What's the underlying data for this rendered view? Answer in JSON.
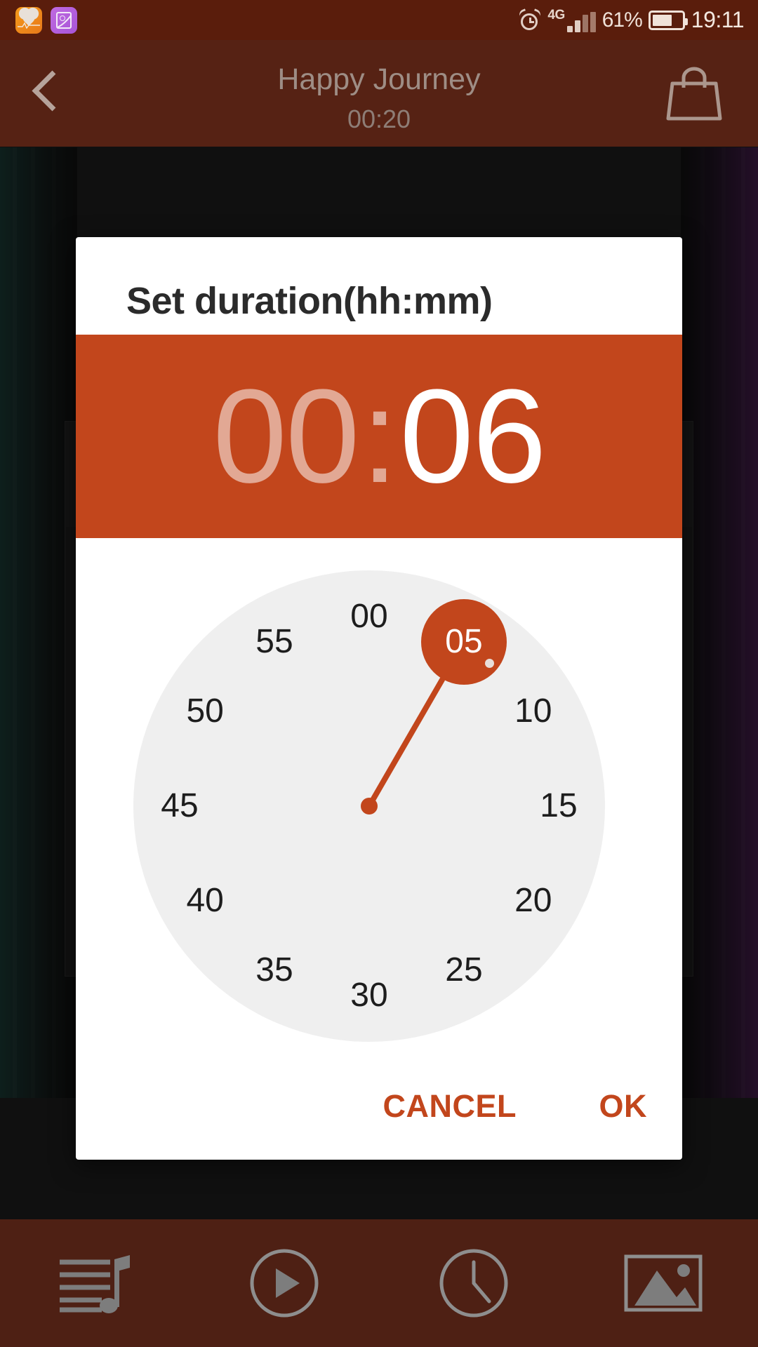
{
  "status_bar": {
    "app_icons": [
      "health-app-icon",
      "gallery-app-icon"
    ],
    "alarm_icon": "alarm-icon",
    "network_type": "4G",
    "signal_icon": "signal-bars-icon",
    "battery_percent": "61%",
    "battery_icon": "battery-icon",
    "battery_level": 60,
    "clock": "19:11",
    "background_color": "#5a1d0c"
  },
  "app_header": {
    "back_icon": "chevron-left-icon",
    "title": "Happy Journey",
    "subtitle": "00:20",
    "bag_icon": "shopping-bag-icon",
    "background_color": "#562214"
  },
  "dialog": {
    "title": "Set duration(hh:mm)",
    "accent_color": "#c2461c",
    "time": {
      "hours": "00",
      "separator": ":",
      "minutes": "06",
      "selected_field": "minutes"
    },
    "clock": {
      "mode": "minutes",
      "selected_value": "05",
      "dial_color": "#efefef",
      "labels": [
        {
          "text": "00",
          "angle": 0
        },
        {
          "text": "05",
          "angle": 30
        },
        {
          "text": "10",
          "angle": 60
        },
        {
          "text": "15",
          "angle": 90
        },
        {
          "text": "20",
          "angle": 120
        },
        {
          "text": "25",
          "angle": 150
        },
        {
          "text": "30",
          "angle": 180
        },
        {
          "text": "35",
          "angle": 210
        },
        {
          "text": "40",
          "angle": 240
        },
        {
          "text": "45",
          "angle": 270
        },
        {
          "text": "50",
          "angle": 300
        },
        {
          "text": "55",
          "angle": 330
        }
      ]
    },
    "cancel_label": "CANCEL",
    "ok_label": "OK"
  },
  "bottom_nav": {
    "background_color": "#4e2014",
    "items": [
      {
        "icon": "playlist-music-icon"
      },
      {
        "icon": "play-circle-icon"
      },
      {
        "icon": "clock-icon"
      },
      {
        "icon": "image-icon"
      }
    ]
  }
}
